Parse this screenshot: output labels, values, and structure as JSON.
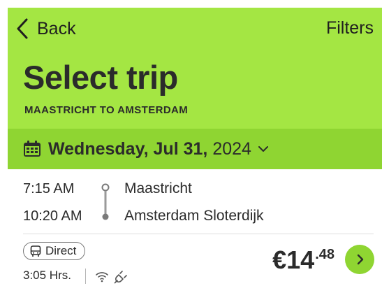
{
  "nav": {
    "back_label": "Back",
    "filters_label": "Filters"
  },
  "header": {
    "title": "Select trip",
    "subtitle": "MAASTRICHT TO AMSTERDAM"
  },
  "date": {
    "day_text": "Wednesday, Jul 31,",
    "year": "2024"
  },
  "trip": {
    "departure_time": "7:15 AM",
    "arrival_time": "10:20 AM",
    "departure_station": "Maastricht",
    "arrival_station": "Amsterdam Sloterdijk",
    "type_badge": "Direct",
    "duration": "3:05 Hrs.",
    "amenities": [
      "wifi-icon",
      "power-plug-icon"
    ],
    "price_main": "€14",
    "price_cents": ".48"
  },
  "colors": {
    "header_green": "#a4e643",
    "date_green": "#8fd532",
    "text_dark": "#2b2b2b"
  }
}
